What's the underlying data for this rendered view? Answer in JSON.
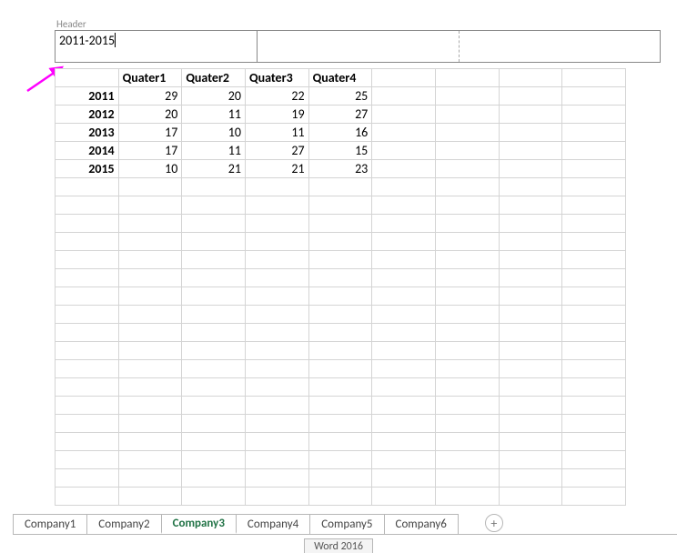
{
  "header": {
    "label": "Header",
    "left_value": "2011-2015",
    "center_value": "",
    "right_value": ""
  },
  "columns": [
    "Quater1",
    "Quater2",
    "Quater3",
    "Quater4"
  ],
  "rows": [
    {
      "year": "2011",
      "values": [
        29,
        20,
        22,
        25
      ]
    },
    {
      "year": "2012",
      "values": [
        20,
        11,
        19,
        27
      ]
    },
    {
      "year": "2013",
      "values": [
        17,
        10,
        11,
        16
      ]
    },
    {
      "year": "2014",
      "values": [
        17,
        11,
        27,
        15
      ]
    },
    {
      "year": "2015",
      "values": [
        10,
        21,
        21,
        23
      ]
    }
  ],
  "tabs": [
    "Company1",
    "Company2",
    "Company3",
    "Company4",
    "Company5",
    "Company6"
  ],
  "active_tab_index": 2,
  "status": "Word 2016",
  "plus": "+"
}
